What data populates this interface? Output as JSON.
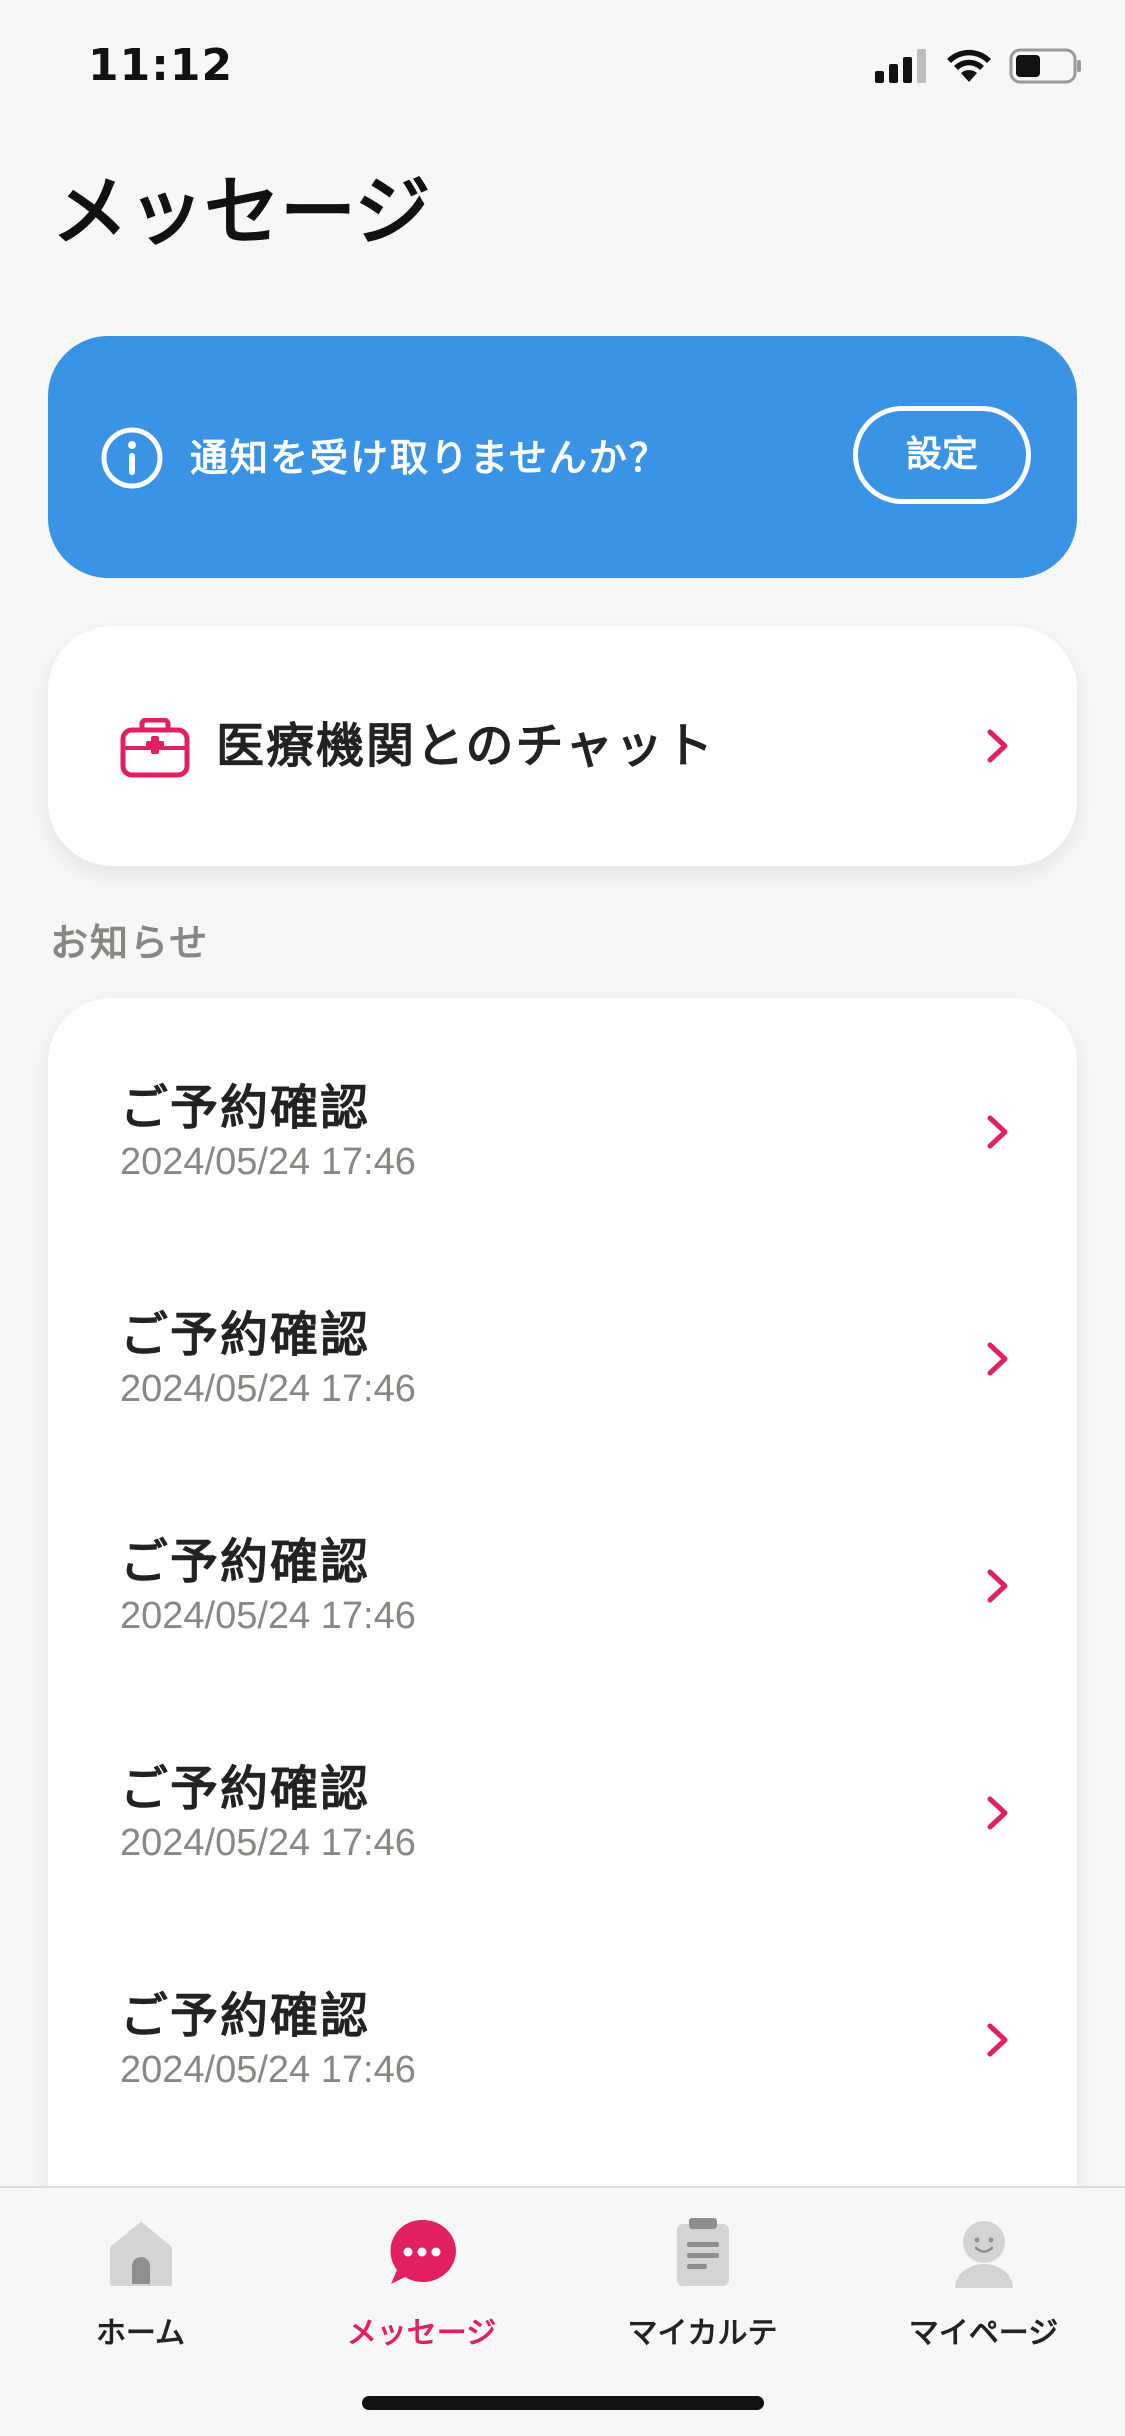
{
  "status_bar": {
    "time": "11:12"
  },
  "header": {
    "title": "メッセージ"
  },
  "notify_banner": {
    "icon": "info-icon",
    "text": "通知を受け取りませんか？",
    "button_label": "設定",
    "background_color": "#3a93e4"
  },
  "chat_card": {
    "icon": "medical-bag-icon",
    "label": "医療機関とのチャット"
  },
  "notices": {
    "section_label": "お知らせ",
    "items": [
      {
        "title": "ご予約確認",
        "date": "2024/05/24 17:46"
      },
      {
        "title": "ご予約確認",
        "date": "2024/05/24 17:46"
      },
      {
        "title": "ご予約確認",
        "date": "2024/05/24 17:46"
      },
      {
        "title": "ご予約確認",
        "date": "2024/05/24 17:46"
      },
      {
        "title": "ご予約確認",
        "date": "2024/05/24 17:46"
      }
    ]
  },
  "tab_bar": {
    "active_color": "#e0205f",
    "tabs": [
      {
        "label": "ホーム",
        "icon": "home-icon",
        "active": false
      },
      {
        "label": "メッセージ",
        "icon": "chat-bubble-icon",
        "active": true
      },
      {
        "label": "マイカルテ",
        "icon": "clipboard-icon",
        "active": false
      },
      {
        "label": "マイページ",
        "icon": "person-icon",
        "active": false
      }
    ]
  }
}
